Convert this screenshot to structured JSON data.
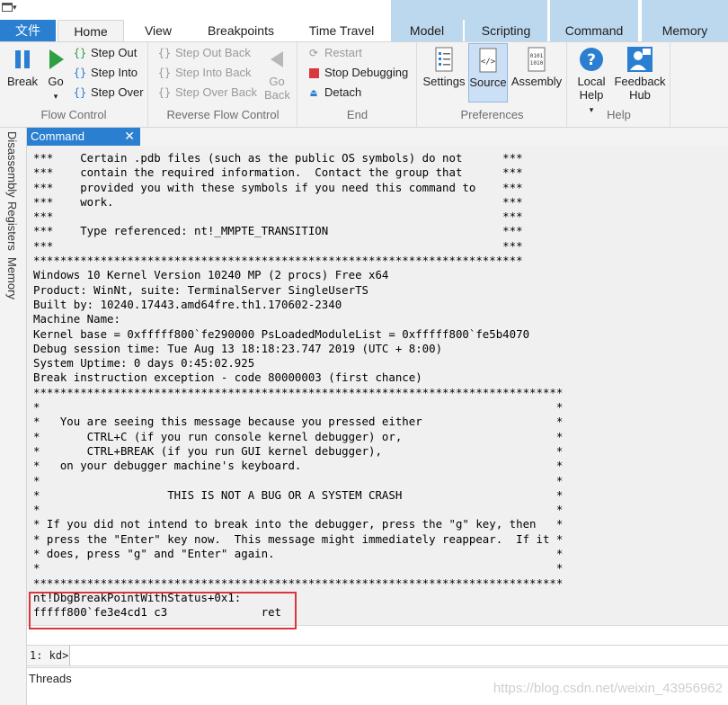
{
  "ribbon_tabs": {
    "file": "文件",
    "home": "Home",
    "view": "View",
    "breakpoints": "Breakpoints",
    "time_travel": "Time Travel",
    "model": "Model",
    "scripting": "Scripting",
    "command": "Command",
    "memory": "Memory"
  },
  "flow_control": {
    "label": "Flow Control",
    "break": "Break",
    "go": "Go",
    "step_out": "Step Out",
    "step_into": "Step Into",
    "step_over": "Step Over"
  },
  "reverse_flow_control": {
    "label": "Reverse Flow Control",
    "step_out_back": "Step Out Back",
    "step_into_back": "Step Into Back",
    "step_over_back": "Step Over Back",
    "go_back": "Go Back"
  },
  "end": {
    "label": "End",
    "restart": "Restart",
    "stop_debugging": "Stop Debugging",
    "detach": "Detach"
  },
  "preferences": {
    "label": "Preferences",
    "settings": "Settings",
    "source": "Source",
    "assembly": "Assembly"
  },
  "help": {
    "label": "Help",
    "local_help": "Local Help",
    "feedback_hub": "Feedback Hub"
  },
  "side_tabs": {
    "disassembly": "Disassembly",
    "registers": "Registers",
    "memory": "Memory"
  },
  "command_window": {
    "tab_label": "Command",
    "close_glyph": "✕",
    "prompt": "1: kd>",
    "input_value": "",
    "output_text": "***    Certain .pdb files (such as the public OS symbols) do not      ***\n***    contain the required information.  Contact the group that      ***\n***    provided you with these symbols if you need this command to    ***\n***    work.                                                          ***\n***                                                                   ***\n***    Type referenced: nt!_MMPTE_TRANSITION                          ***\n***                                                                   ***\n*************************************************************************\nWindows 10 Kernel Version 10240 MP (2 procs) Free x64\nProduct: WinNt, suite: TerminalServer SingleUserTS\nBuilt by: 10240.17443.amd64fre.th1.170602-2340\nMachine Name:\nKernel base = 0xfffff800`fe290000 PsLoadedModuleList = 0xfffff800`fe5b4070\nDebug session time: Tue Aug 13 18:18:23.747 2019 (UTC + 8:00)\nSystem Uptime: 0 days 0:45:02.925\nBreak instruction exception - code 80000003 (first chance)\n*******************************************************************************\n*                                                                             *\n*   You are seeing this message because you pressed either                    *\n*       CTRL+C (if you run console kernel debugger) or,                       *\n*       CTRL+BREAK (if you run GUI kernel debugger),                          *\n*   on your debugger machine's keyboard.                                      *\n*                                                                             *\n*                   THIS IS NOT A BUG OR A SYSTEM CRASH                       *\n*                                                                             *\n* If you did not intend to break into the debugger, press the \"g\" key, then   *\n* press the \"Enter\" key now.  This message might immediately reappear.  If it *\n* does, press \"g\" and \"Enter\" again.                                          *\n*                                                                             *\n*******************************************************************************\nnt!DbgBreakPointWithStatus+0x1:\nfffff800`fe3e4cd1 c3              ret"
  },
  "threads_panel": {
    "label": "Threads"
  },
  "watermark": "https://blog.csdn.net/weixin_43956962",
  "colors": {
    "accent": "#2b7fd0",
    "context_tab": "#bcd8ee",
    "highlight_border": "#d9363e",
    "output_bg": "#f0f0f0"
  }
}
